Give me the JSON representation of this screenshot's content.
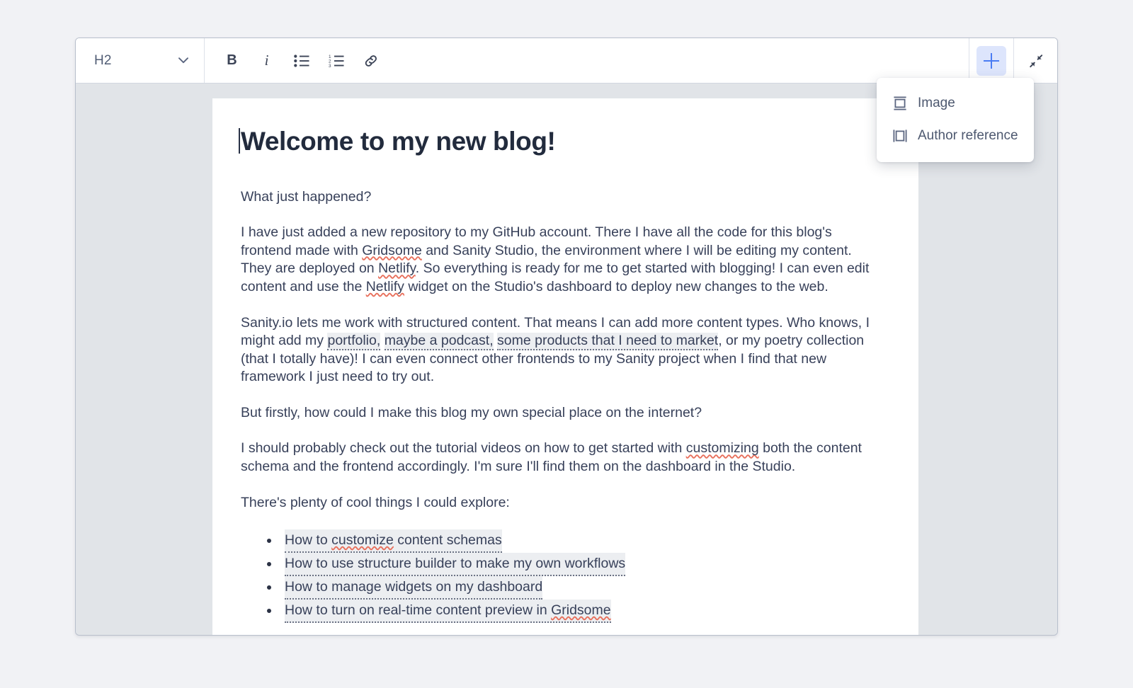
{
  "toolbar": {
    "style_select": {
      "value": "H2",
      "icon": "chevron-down-icon"
    },
    "buttons": [
      {
        "name": "bold",
        "label": "B",
        "icon": "bold-icon"
      },
      {
        "name": "italic",
        "label": "i",
        "icon": "italic-icon"
      },
      {
        "name": "bullet-list",
        "label": "",
        "icon": "bullet-list-icon"
      },
      {
        "name": "numbered-list",
        "label": "",
        "icon": "numbered-list-icon"
      },
      {
        "name": "link",
        "label": "",
        "icon": "link-icon"
      }
    ],
    "insert_button": {
      "icon": "plus-icon",
      "label": ""
    },
    "collapse_button": {
      "icon": "collapse-arrows-icon",
      "label": ""
    }
  },
  "insert_menu": {
    "open": true,
    "items": [
      {
        "label": "Image",
        "icon": "image-block-icon"
      },
      {
        "label": "Author reference",
        "icon": "reference-block-icon"
      }
    ]
  },
  "document": {
    "title": "Welcome to my new blog!",
    "paragraphs": {
      "p1": "What just happened?",
      "p2_a": "I have just added a new repository to my GitHub account. There I have all the code for this blog's frontend made with ",
      "p2_m1": "Gridsome",
      "p2_b": " and Sanity Studio, the environment where I will be editing my content. They are deployed on ",
      "p2_m2": "Netlify",
      "p2_c": ". So everything is ready for me to get started with blogging! I can even edit content and use the ",
      "p2_m3": "Netlify",
      "p2_d": " widget on the Studio's dashboard to deploy new changes to the web.",
      "p3_a": "Sanity.io lets me work with structured content. That means I can add more content types. Who knows, I might add my ",
      "p3_link1": "portfolio,",
      "p3_link2": "maybe a podcast,",
      "p3_link3": "some products that I need to market",
      "p3_b": ", or my poetry collection (that I totally have)! I can even connect other frontends to my Sanity project when I find that new framework I just need to try out.",
      "p4": "But firstly, how could I make this blog my own special place on the internet?",
      "p5_a": "I should probably check out the tutorial videos on how to get started with ",
      "p5_m1": "customizing",
      "p5_b": " both the content schema and the frontend accordingly. I'm sure I'll find them on the dashboard in the Studio.",
      "p6": "There's plenty of cool things I could explore:"
    },
    "list_items": [
      {
        "text": "How to customize content schemas",
        "misspelled": "customize"
      },
      {
        "text": "How to use structure builder to make my own workflows",
        "misspelled": ""
      },
      {
        "text": "How to manage widgets on my dashboard",
        "misspelled": ""
      },
      {
        "text": "How to turn on real-time content preview in Gridsome",
        "misspelled": "Gridsome"
      }
    ]
  },
  "colors": {
    "accent_blue": "#4a7cf3",
    "insert_button_bg": "#dde5fc",
    "canvas_gray": "#e1e4e8",
    "page_bg": "#f1f2f5",
    "text": "#38415a",
    "title": "#222b3d",
    "spellcheck_red": "#e8705c",
    "annotation_bg": "#eceef1"
  }
}
